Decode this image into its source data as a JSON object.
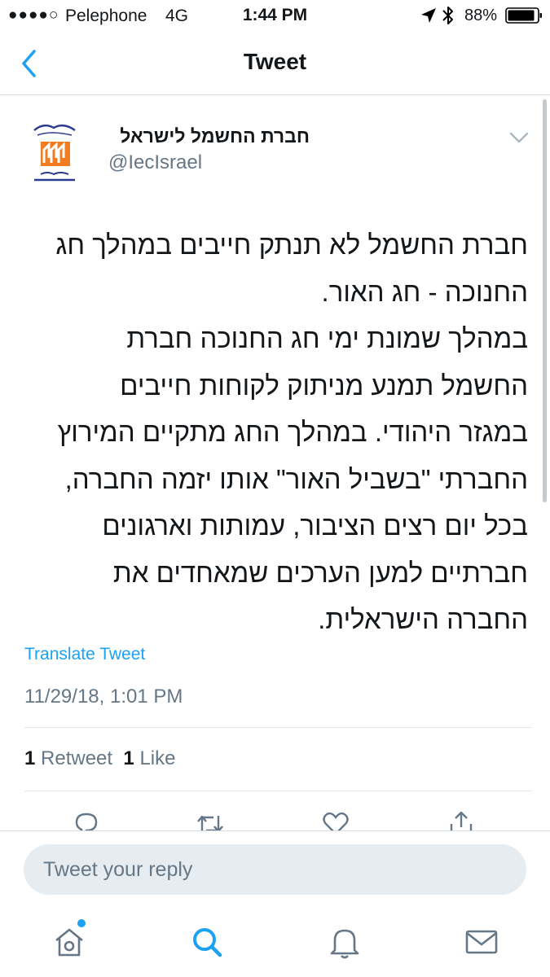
{
  "status_bar": {
    "signal": "●●●●○",
    "carrier": "Pelephone",
    "network": "4G",
    "time": "1:44 PM",
    "battery_percent": "88%"
  },
  "nav": {
    "title": "Tweet",
    "back_icon": "chevron-left-icon"
  },
  "tweet": {
    "author": {
      "name": "חברת החשמל לישראל",
      "handle": "@IecIsrael",
      "avatar_icon": "company-logo"
    },
    "text": "חברת החשמל לא תנתק חייבים במהלך חג\nהחנוכה - חג האור.\nבמהלך שמונת ימי חג החנוכה חברת\nהחשמל  תמנע מניתוק לקוחות חייבים\nבמגזר היהודי. במהלך החג מתקיים המירוץ\nהחברתי \"בשביל האור\" אותו יזמה החברה,\nבכל יום רצים הציבור, עמותות וארגונים\nחברתיים למען הערכים שמאחדים את\nהחברה הישראלית.",
    "translate_label": "Translate Tweet",
    "timestamp": "11/29/18, 1:01 PM",
    "stats": {
      "retweets_count": "1",
      "retweets_label": "Retweet",
      "likes_count": "1",
      "likes_label": "Like"
    }
  },
  "reply": {
    "placeholder": "Tweet your reply"
  },
  "tabbar": {
    "items": [
      "home-icon",
      "search-icon",
      "bell-icon",
      "mail-icon"
    ],
    "has_notification_on": "home"
  },
  "colors": {
    "accent": "#1da1f2",
    "muted": "#657786",
    "text": "#14171a",
    "logo_orange": "#f47c20"
  }
}
